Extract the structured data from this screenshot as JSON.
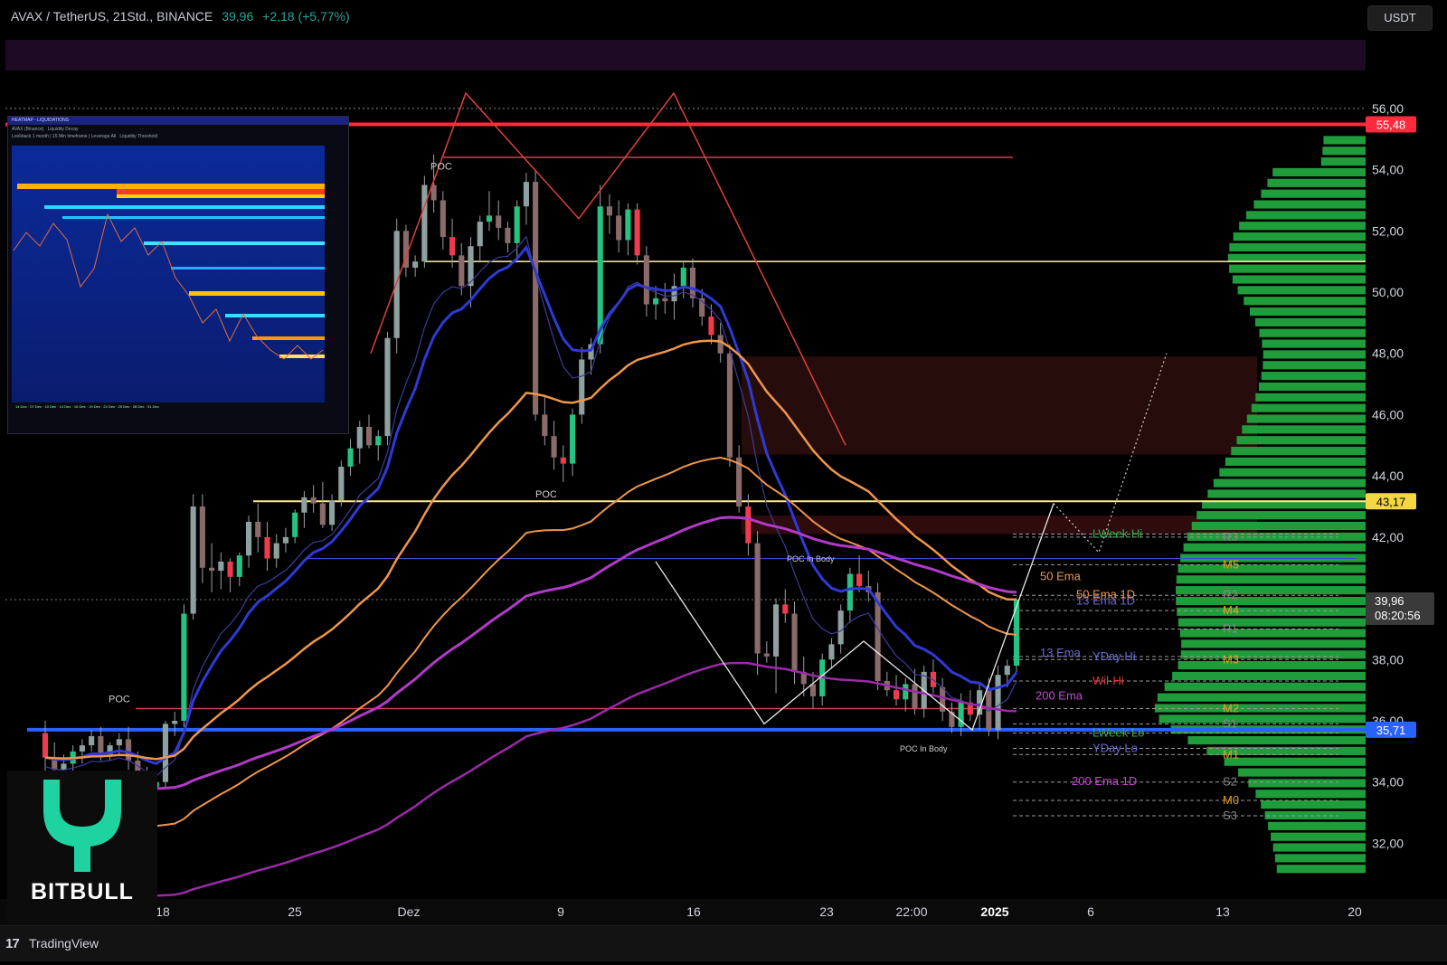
{
  "header": {
    "symbol": "AVAX / TetherUS, 21Std., BINANCE",
    "price": "39,96",
    "change": "+2,18 (+5,77%)"
  },
  "currency_button": "USDT",
  "footer": {
    "logo_mark": "17",
    "brand": "TradingView"
  },
  "watermark": {
    "brand": "BITBULL",
    "accent": "#1fd3a0"
  },
  "inset": {
    "title": "HEATMAP - LIQUIDATIONS",
    "line1": "AVAX (Binance)",
    "line2": "Lookback 1 month | 15 Min timeframe | Leverage All",
    "slider1": "Liquidity Decay",
    "slider2": "Liquidity Threshold"
  },
  "colors": {
    "up": "#26c281",
    "down": "#ef3b4e",
    "bg": "#000000",
    "ema13": "#2f3ad6",
    "ema50": "#f0964a",
    "ema200": "#b23ac8",
    "support_blue": "#2962ff",
    "resistance_red": "#ff2a3c",
    "yellow": "#ffeb7a",
    "volume_profile": "#1f9d3a"
  },
  "chart_data": {
    "type": "candlestick",
    "title": "AVAX / TetherUS, 21Std., BINANCE",
    "y_axis": {
      "ticks": [
        "56,00",
        "54,00",
        "52,00",
        "50,00",
        "48,00",
        "46,00",
        "44,00",
        "42,00",
        "40,00",
        "38,00",
        "36,00",
        "34,00",
        "32,00"
      ],
      "ylim": [
        30.3,
        58.3
      ],
      "side": "right"
    },
    "x_axis": {
      "ticks": [
        "18",
        "25",
        "Dez",
        "9",
        "16",
        "23",
        "22:00",
        "2025",
        "6",
        "13",
        "20"
      ]
    },
    "price_labels": [
      {
        "text": "55,48",
        "value": 55.48,
        "color": "#ff2a3c"
      },
      {
        "text": "43,17",
        "value": 43.17,
        "color": "#f5d743"
      },
      {
        "text": "35,71",
        "value": 35.71,
        "color": "#2962ff"
      }
    ],
    "current_price": {
      "value": 39.96,
      "text": "39,96",
      "countdown": "08:20:56"
    },
    "candles": [
      [
        35.6,
        36.0,
        34.3,
        34.8
      ],
      [
        34.8,
        35.3,
        34.0,
        34.4
      ],
      [
        34.4,
        34.9,
        34.0,
        34.6
      ],
      [
        34.6,
        35.2,
        34.2,
        35.0
      ],
      [
        35.0,
        35.4,
        34.6,
        35.2
      ],
      [
        35.2,
        35.7,
        35.0,
        35.5
      ],
      [
        35.5,
        35.8,
        34.7,
        34.9
      ],
      [
        34.9,
        35.3,
        34.7,
        35.2
      ],
      [
        35.2,
        35.6,
        34.9,
        35.4
      ],
      [
        35.4,
        35.8,
        34.4,
        34.7
      ],
      [
        34.7,
        35.0,
        33.6,
        34.1
      ],
      [
        34.1,
        34.5,
        33.5,
        33.8
      ],
      [
        33.8,
        34.3,
        33.4,
        34.0
      ],
      [
        34.0,
        36.0,
        33.8,
        35.9
      ],
      [
        35.9,
        36.3,
        35.5,
        36.0
      ],
      [
        36.0,
        39.8,
        35.8,
        39.5
      ],
      [
        39.5,
        43.4,
        39.3,
        43.0
      ],
      [
        43.0,
        43.4,
        40.5,
        41.0
      ],
      [
        41.0,
        41.8,
        40.2,
        40.9
      ],
      [
        40.9,
        41.5,
        40.3,
        41.2
      ],
      [
        41.2,
        41.3,
        40.2,
        40.7
      ],
      [
        40.7,
        41.5,
        40.4,
        41.4
      ],
      [
        41.4,
        42.7,
        41.0,
        42.5
      ],
      [
        42.5,
        43.1,
        41.5,
        42.0
      ],
      [
        42.0,
        42.5,
        40.9,
        41.3
      ],
      [
        41.3,
        42.1,
        41.0,
        41.8
      ],
      [
        41.8,
        42.3,
        41.5,
        42.0
      ],
      [
        42.0,
        42.9,
        41.8,
        42.8
      ],
      [
        42.8,
        43.5,
        42.3,
        43.3
      ],
      [
        43.3,
        43.7,
        42.8,
        43.1
      ],
      [
        43.1,
        43.8,
        42.3,
        42.4
      ],
      [
        42.4,
        43.4,
        42.2,
        43.2
      ],
      [
        43.2,
        44.5,
        43.0,
        44.3
      ],
      [
        44.3,
        45.2,
        44.0,
        44.9
      ],
      [
        44.9,
        45.8,
        44.4,
        45.6
      ],
      [
        45.6,
        46.0,
        44.9,
        45.0
      ],
      [
        45.0,
        45.5,
        44.5,
        45.3
      ],
      [
        45.3,
        48.7,
        45.0,
        48.5
      ],
      [
        48.5,
        52.4,
        48.0,
        52.0
      ],
      [
        52.0,
        52.2,
        50.5,
        50.8
      ],
      [
        50.8,
        51.2,
        50.5,
        51.0
      ],
      [
        51.0,
        53.8,
        50.8,
        53.5
      ],
      [
        53.5,
        54.5,
        52.6,
        53.0
      ],
      [
        53.0,
        53.3,
        51.4,
        51.8
      ],
      [
        51.8,
        52.4,
        50.8,
        51.2
      ],
      [
        51.2,
        51.6,
        49.9,
        50.2
      ],
      [
        50.2,
        51.8,
        49.5,
        51.5
      ],
      [
        51.5,
        52.5,
        51.0,
        52.3
      ],
      [
        52.3,
        53.3,
        52.0,
        52.5
      ],
      [
        52.5,
        53.0,
        51.7,
        52.1
      ],
      [
        52.1,
        52.3,
        51.3,
        51.6
      ],
      [
        51.6,
        53.0,
        51.0,
        52.8
      ],
      [
        52.8,
        53.9,
        52.2,
        53.6
      ],
      [
        53.6,
        54.0,
        45.8,
        46.0
      ],
      [
        46.0,
        46.6,
        45.0,
        45.3
      ],
      [
        45.3,
        45.8,
        44.2,
        44.6
      ],
      [
        44.6,
        45.0,
        43.8,
        44.4
      ],
      [
        44.4,
        46.2,
        44.0,
        46.0
      ],
      [
        46.0,
        48.2,
        45.7,
        47.8
      ],
      [
        47.8,
        48.5,
        47.3,
        48.3
      ],
      [
        48.3,
        53.5,
        48.0,
        52.8
      ],
      [
        52.8,
        53.2,
        51.9,
        52.5
      ],
      [
        52.5,
        53.0,
        51.3,
        51.7
      ],
      [
        51.7,
        52.9,
        51.2,
        52.7
      ],
      [
        52.7,
        52.9,
        50.9,
        51.2
      ],
      [
        51.2,
        51.5,
        49.2,
        49.6
      ],
      [
        49.6,
        50.2,
        49.1,
        49.8
      ],
      [
        49.8,
        50.3,
        49.3,
        49.7
      ],
      [
        49.7,
        50.6,
        49.1,
        50.2
      ],
      [
        50.2,
        51.0,
        49.8,
        50.8
      ],
      [
        50.8,
        51.1,
        49.5,
        49.8
      ],
      [
        49.8,
        50.1,
        48.9,
        49.2
      ],
      [
        49.2,
        49.6,
        48.3,
        48.6
      ],
      [
        48.6,
        49.0,
        47.7,
        48.0
      ],
      [
        48.0,
        48.3,
        44.3,
        44.6
      ],
      [
        44.6,
        45.0,
        42.8,
        43.0
      ],
      [
        43.0,
        43.4,
        41.4,
        41.8
      ],
      [
        41.8,
        42.2,
        37.5,
        38.2
      ],
      [
        38.2,
        38.6,
        37.9,
        38.1
      ],
      [
        38.1,
        40.0,
        36.9,
        39.8
      ],
      [
        39.8,
        40.3,
        39.2,
        39.5
      ],
      [
        39.5,
        39.9,
        37.2,
        37.6
      ],
      [
        37.6,
        38.1,
        36.8,
        37.2
      ],
      [
        37.2,
        37.6,
        36.4,
        36.8
      ],
      [
        36.8,
        38.2,
        36.5,
        38.0
      ],
      [
        38.0,
        38.7,
        37.7,
        38.5
      ],
      [
        38.5,
        39.8,
        38.2,
        39.6
      ],
      [
        39.6,
        41.0,
        39.2,
        40.8
      ],
      [
        40.8,
        41.4,
        40.2,
        40.4
      ],
      [
        40.4,
        40.9,
        39.9,
        40.2
      ],
      [
        40.2,
        40.5,
        37.0,
        37.3
      ],
      [
        37.3,
        37.6,
        36.8,
        37.0
      ],
      [
        37.0,
        37.5,
        36.5,
        36.7
      ],
      [
        36.7,
        37.4,
        36.3,
        37.2
      ],
      [
        37.2,
        37.7,
        36.2,
        36.4
      ],
      [
        36.4,
        37.8,
        36.1,
        37.6
      ],
      [
        37.6,
        38.0,
        36.9,
        37.1
      ],
      [
        37.1,
        37.4,
        36.0,
        36.3
      ],
      [
        36.3,
        36.6,
        35.6,
        35.8
      ],
      [
        35.8,
        36.9,
        35.5,
        36.6
      ],
      [
        36.6,
        37.0,
        36.0,
        36.2
      ],
      [
        36.2,
        37.2,
        35.7,
        37.0
      ],
      [
        37.0,
        37.4,
        35.5,
        35.7
      ],
      [
        35.7,
        37.8,
        35.4,
        37.5
      ],
      [
        37.5,
        38.0,
        37.1,
        37.8
      ],
      [
        37.8,
        40.0,
        37.6,
        39.96
      ]
    ],
    "indicators": [
      {
        "name": "13 Ema",
        "color": "#2f3ad6"
      },
      {
        "name": "13 Ema 1D",
        "color": "#3c3c9a"
      },
      {
        "name": "50 Ema",
        "color": "#f0964a"
      },
      {
        "name": "50 Ema 1D",
        "color": "#f0964a"
      },
      {
        "name": "200 Ema",
        "color": "#b23ac8"
      },
      {
        "name": "200 Ema 1D",
        "color": "#9c2aa8"
      }
    ],
    "levels": [
      {
        "text": "LWeek Hi",
        "value": 42.1
      },
      {
        "text": "YDay Hi",
        "value": 38.1
      },
      {
        "text": "Wil-Hi",
        "value": 37.3
      },
      {
        "text": "LWeek Lo",
        "value": 35.6
      },
      {
        "text": "YDay Lo",
        "value": 35.1
      },
      {
        "text": "R3",
        "value": 42.0
      },
      {
        "text": "M5",
        "value": 41.1
      },
      {
        "text": "R2",
        "value": 40.1
      },
      {
        "text": "M4",
        "value": 39.6
      },
      {
        "text": "R1",
        "value": 39.0
      },
      {
        "text": "M3",
        "value": 38.0
      },
      {
        "text": "M2",
        "value": 36.4
      },
      {
        "text": "S1",
        "value": 35.9
      },
      {
        "text": "M1",
        "value": 34.9
      },
      {
        "text": "S2",
        "value": 34.0
      },
      {
        "text": "M0",
        "value": 33.4
      },
      {
        "text": "S3",
        "value": 32.9
      }
    ],
    "annotations": [
      "POC",
      "POC",
      "POC",
      "POC In Body",
      "POC In Body"
    ]
  }
}
